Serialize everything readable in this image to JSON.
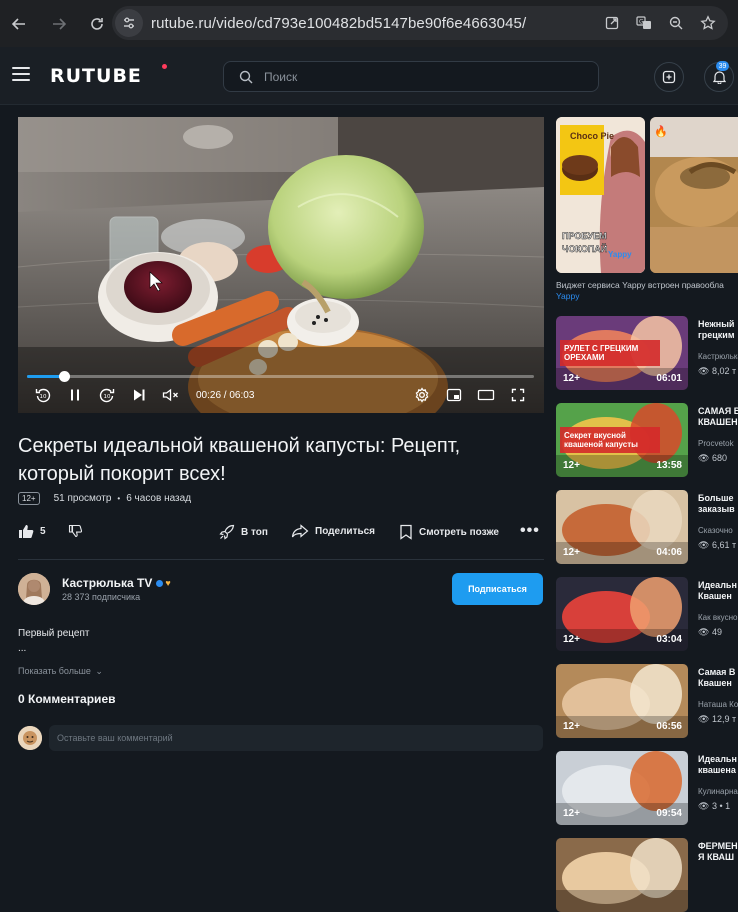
{
  "browser": {
    "url": "rutube.ru/video/cd793e100482bd5147be90f6e4663045/"
  },
  "header": {
    "logo": "RUTUBE",
    "search_placeholder": "Поиск",
    "notification_count": "39"
  },
  "player": {
    "time": "00:26 / 06:03",
    "progress_fraction": 0.072
  },
  "video": {
    "title": "Секреты идеальной квашеной капусты: Рецепт, который покорит всех!",
    "age": "12+",
    "views": "51 просмотр",
    "published": "6 часов назад",
    "likes": "5",
    "actions": {
      "top": "В топ",
      "share": "Поделиться",
      "watch_later": "Смотреть позже"
    }
  },
  "channel": {
    "name": "Кастрюлька TV",
    "subscribers": "28 373 подписчика",
    "subscribe_label": "Подписаться"
  },
  "description": {
    "line1": "Первый рецепт",
    "line2": "...",
    "show_more": "Показать больше"
  },
  "comments": {
    "title": "0 Комментариев",
    "placeholder": "Оставьте ваш комментарий"
  },
  "promo": {
    "card1_top": "Choco Pie",
    "card1_caption_line1": "ПРОБУЕМ",
    "card1_caption_line2": "ЧОКОПАЙ",
    "card1_brand": "Yappy",
    "text": "Виджет сервиса Yappy встроен правообла",
    "brand": "Yappy"
  },
  "recommendations": [
    {
      "overlay": "РУЛЕТ С ГРЕЦКИМ ОРЕХАМИ",
      "age": "12+",
      "duration": "06:01",
      "title_1": "Нежный",
      "title_2": "грецким",
      "author": "Кастрюлька",
      "views": "8,02 т"
    },
    {
      "overlay": "Секрет вкусной квашеной капусты",
      "age": "12+",
      "duration": "13:58",
      "title_1": "САМАЯ В",
      "title_2": "КВАШЕН",
      "author": "Procvetok",
      "views": "680"
    },
    {
      "overlay": "",
      "age": "12+",
      "duration": "04:06",
      "title_1": "Больше",
      "title_2": "заказыв",
      "author": "Сказочно",
      "views": "6,61 т"
    },
    {
      "overlay": "",
      "age": "12+",
      "duration": "03:04",
      "title_1": "Идеальн",
      "title_2": "Квашен",
      "author": "Как вкусно",
      "views": "49"
    },
    {
      "overlay": "",
      "age": "12+",
      "duration": "06:56",
      "title_1": "Самая В",
      "title_2": "Квашен",
      "author": "Наташа Ко",
      "views": "12,9 т"
    },
    {
      "overlay": "",
      "age": "12+",
      "duration": "09:54",
      "title_1": "Идеальн",
      "title_2": "квашена",
      "author": "Кулинарна",
      "views": "3 • 1"
    },
    {
      "overlay": "",
      "age": "",
      "duration": "",
      "title_1": "ФЕРМЕН",
      "title_2": "Я КВАШ",
      "author": "",
      "views": ""
    }
  ]
}
